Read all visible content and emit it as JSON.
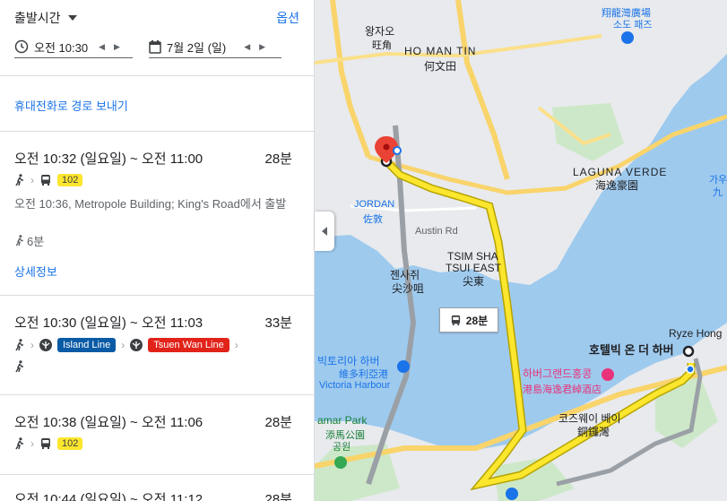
{
  "header": {
    "depart_label": "출발시간",
    "options_label": "옵션",
    "time_value": "오전 10:30",
    "date_value": "7월 2일 (일)"
  },
  "send_to_phone": "휴대전화로 경로 보내기",
  "routes": [
    {
      "time_range": "오전 10:32 (일요일) ~ 오전 11:00",
      "duration": "28분",
      "bus": "102",
      "description": "오전 10:36, Metropole Building; King's Road에서 출발",
      "walk": "6분",
      "details": "상세정보"
    },
    {
      "time_range": "오전 10:30 (일요일) ~ 오전 11:03",
      "duration": "33분",
      "line1": "Island Line",
      "line1_color": "#0a5ba6",
      "line2": "Tsuen Wan Line",
      "line2_color": "#e2231a"
    },
    {
      "time_range": "오전 10:38 (일요일) ~ 오전 11:06",
      "duration": "28분",
      "bus": "102"
    },
    {
      "time_range": "오전 10:44 (일요일) ~ 오전 11:12",
      "duration": "28분"
    }
  ],
  "map": {
    "bus_chip": "28분",
    "labels": {
      "wongtaisin": "왕자오",
      "wongtaisin_cn": "旺角",
      "homantin": "HO MAN TIN",
      "homantin_cn": "何文田",
      "laguna": "LAGUNA VERDE",
      "laguna_cn": "海逸豪園",
      "jordan": "JORDAN",
      "jordan_cn": "佐敦",
      "tst": "젠사쥐",
      "tst_cn": "尖沙咀",
      "tste": "TSIM SHA",
      "tste2": "TSUI EAST",
      "tste_cn": "尖東",
      "victoria": "빅토리아 하버",
      "victoria_cn": "維多利亞港",
      "victoria_en": "Victoria Harbour",
      "hotel": "호텔빅 온 더 하버",
      "grand": "하버그랜드홍콩",
      "grand_cn": "港島海逸君綽酒店",
      "causeway": "코즈웨이 베이",
      "causeway_cn": "銅鑼灣",
      "victoriapark": "amar Park",
      "victoriapark_cn": "添馬公園",
      "victoriapark_kr": "공원",
      "ryze": "Ryze Hong",
      "top_cn": "翔龍灣廣場",
      "top_kr": "소도 패즈",
      "austin": "Austin Rd",
      "right_kr": "가우",
      "right_cn": "九"
    }
  }
}
